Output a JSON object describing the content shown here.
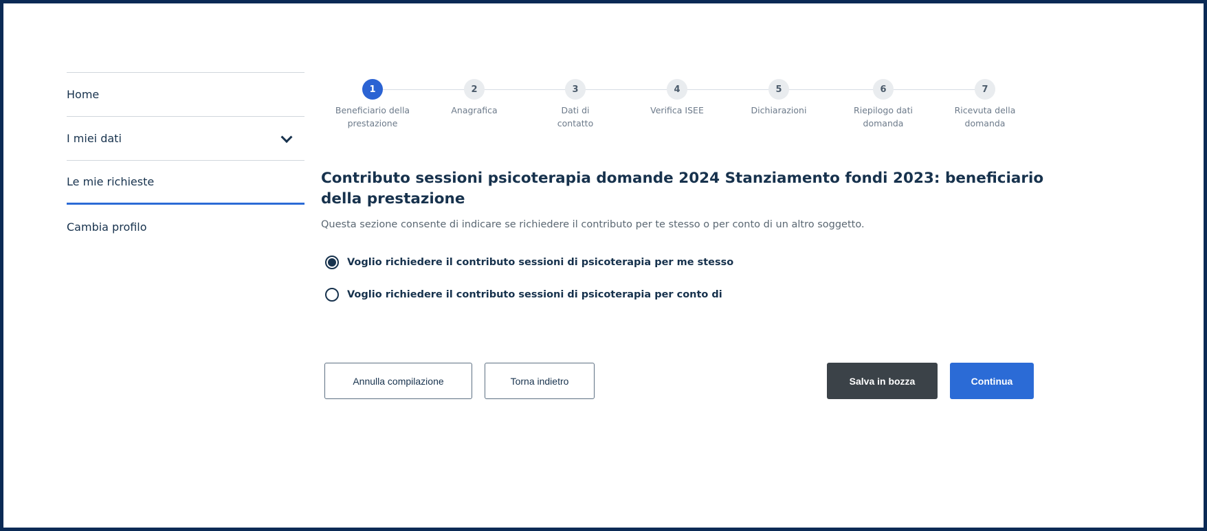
{
  "sidebar": {
    "items": [
      {
        "label": "Home"
      },
      {
        "label": "I miei dati",
        "icon": "chevron-down-icon"
      },
      {
        "label": "Le mie richieste",
        "active": true
      },
      {
        "label": "Cambia profilo"
      }
    ]
  },
  "stepper": {
    "steps": [
      {
        "number": "1",
        "label": "Beneficiario della prestazione",
        "active": true
      },
      {
        "number": "2",
        "label": "Anagrafica"
      },
      {
        "number": "3",
        "label": "Dati di contatto"
      },
      {
        "number": "4",
        "label": "Verifica ISEE"
      },
      {
        "number": "5",
        "label": "Dichiarazioni"
      },
      {
        "number": "6",
        "label": "Riepilogo dati domanda"
      },
      {
        "number": "7",
        "label": "Ricevuta della domanda"
      }
    ]
  },
  "main": {
    "title": "Contributo sessioni psicoterapia domande 2024 Stanziamento fondi 2023: beneficiario della prestazione",
    "subtitle": "Questa sezione consente di indicare se richiedere il contributo per te stesso o per conto di un altro soggetto.",
    "options": [
      {
        "label": "Voglio richiedere il contributo sessioni di psicoterapia per me stesso",
        "selected": true
      },
      {
        "label": "Voglio richiedere il contributo sessioni di psicoterapia per conto di",
        "selected": false
      }
    ]
  },
  "actions": {
    "cancel_label": "Annulla compilazione",
    "back_label": "Torna indietro",
    "draft_label": "Salva in bozza",
    "continue_label": "Continua"
  },
  "colors": {
    "frame_border": "#0b2a55",
    "primary": "#2b6bd6",
    "text_dark": "#17324d",
    "draft_button": "#3b4248"
  }
}
